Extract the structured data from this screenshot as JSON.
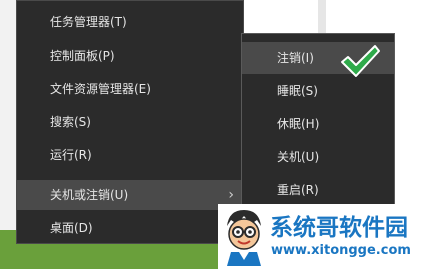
{
  "context_menu": {
    "items": [
      {
        "label": "任务管理器(T)"
      },
      {
        "label": "控制面板(P)"
      },
      {
        "label": "文件资源管理器(E)"
      },
      {
        "label": "搜索(S)"
      },
      {
        "label": "运行(R)"
      },
      {
        "label": "关机或注销(U)",
        "has_submenu": true,
        "active": true
      },
      {
        "label": "桌面(D)"
      }
    ],
    "chevron": "›"
  },
  "submenu": {
    "items": [
      {
        "label": "注销(I)",
        "highlighted": true
      },
      {
        "label": "睡眠(S)"
      },
      {
        "label": "休眠(H)"
      },
      {
        "label": "关机(U)"
      },
      {
        "label": "重启(R)"
      }
    ]
  },
  "annotation": {
    "icon": "checkmark-icon",
    "color": "#2eaa4a"
  },
  "watermark": {
    "title": "系统哥软件园",
    "url": "www.xitongge.com",
    "color": "#1a76c2",
    "icon": "mascot-icon"
  },
  "colors": {
    "menu_bg": "#2b2b2b",
    "menu_hover": "#4a4a4a",
    "menu_text": "#e6e6e6",
    "taskbar": "#6aa03b"
  }
}
